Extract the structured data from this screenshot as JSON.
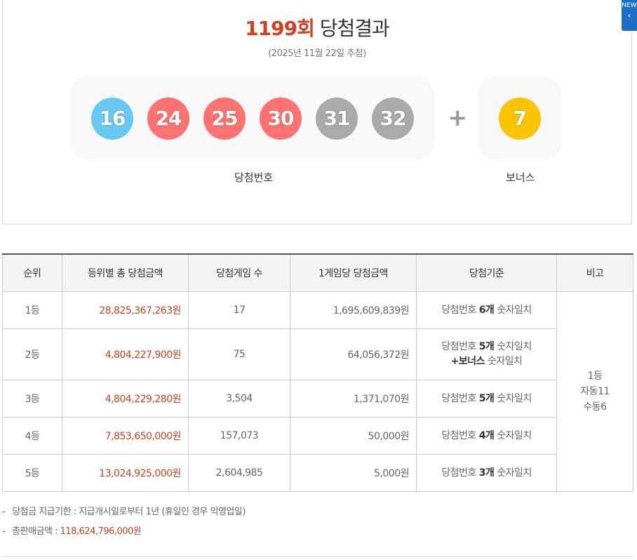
{
  "header": {
    "round": "1199회",
    "title": "당첨결과",
    "date": "(2025년 11월 22일 추첨)"
  },
  "numbers": [
    {
      "value": "16",
      "color": "#69c8f2"
    },
    {
      "value": "24",
      "color": "#ff7272"
    },
    {
      "value": "25",
      "color": "#ff7272"
    },
    {
      "value": "30",
      "color": "#ff7272"
    },
    {
      "value": "31",
      "color": "#aaaaaa"
    },
    {
      "value": "32",
      "color": "#aaaaaa"
    }
  ],
  "bonus": {
    "value": "7",
    "color": "#fbc400"
  },
  "plus_symbol": "+",
  "labels": {
    "winning": "당첨번호",
    "bonus": "보너스"
  },
  "side_tab": {
    "text": "NEW",
    "icon": "chevron-left-icon"
  },
  "table": {
    "headers": [
      "순위",
      "등위별 총 당첨금액",
      "당첨게임 수",
      "1게임당 당첨금액",
      "당첨기준",
      "비고"
    ],
    "rows": [
      {
        "rank": "1등",
        "total": "28,825,367,263원",
        "count": "17",
        "per_game": "1,695,609,839원",
        "criteria_pre": "당첨번호 ",
        "criteria_bold": "6개",
        "criteria_post": " 숫자일치"
      },
      {
        "rank": "2등",
        "total": "4,804,227,900원",
        "count": "75",
        "per_game": "64,056,372원",
        "criteria_pre": "당첨번호 ",
        "criteria_bold": "5개",
        "criteria_post": " 숫자일치",
        "criteria_extra_bold": "+보너스",
        "criteria_extra_post": " 숫자일치"
      },
      {
        "rank": "3등",
        "total": "4,804,229,280원",
        "count": "3,504",
        "per_game": "1,371,070원",
        "criteria_pre": "당첨번호 ",
        "criteria_bold": "5개",
        "criteria_post": " 숫자일치"
      },
      {
        "rank": "4등",
        "total": "7,853,650,000원",
        "count": "157,073",
        "per_game": "50,000원",
        "criteria_pre": "당첨번호 ",
        "criteria_bold": "4개",
        "criteria_post": " 숫자일치"
      },
      {
        "rank": "5등",
        "total": "13,024,925,000원",
        "count": "2,604,985",
        "per_game": "5,000원",
        "criteria_pre": "당첨번호 ",
        "criteria_bold": "3개",
        "criteria_post": " 숫자일치"
      }
    ],
    "note": {
      "line1": "1등",
      "line2": "자동11",
      "line3": "수동6"
    }
  },
  "footer": {
    "dash": "-",
    "deadline": "당첨금 지급기한 : 지급개시일로부터 1년 (휴일인 경우 익영업일)",
    "sales_label": "총판매금액 : ",
    "sales_value": "118,624,796,000원"
  }
}
